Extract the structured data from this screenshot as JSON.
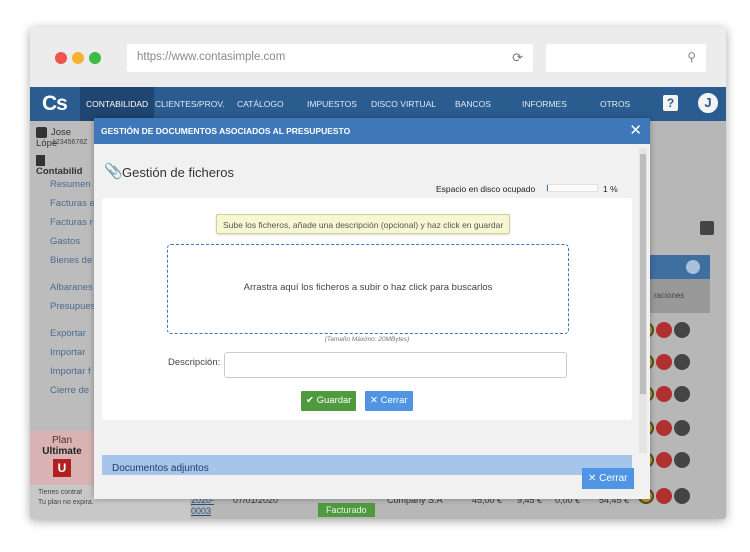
{
  "browser": {
    "url": "https://www.contasimple.com"
  },
  "app": {
    "logo": "Cs",
    "nav": [
      {
        "label": "CONTABILIDAD"
      },
      {
        "label": "CLIENTES/PROV."
      },
      {
        "label": "CATÁLOGO"
      },
      {
        "label": "IMPUESTOS"
      },
      {
        "label": "DISCO VIRTUAL"
      },
      {
        "label": "BANCOS"
      },
      {
        "label": "INFORMES"
      },
      {
        "label": "OTROS"
      }
    ],
    "help_label": "?",
    "avatar_initial": "J"
  },
  "sidebar": {
    "user_name": "Jose Lópe",
    "user_id": "12345678Z",
    "section_title": "Contabilid",
    "items": [
      {
        "label": "Resumen"
      },
      {
        "label": "Facturas e"
      },
      {
        "label": "Facturas r"
      },
      {
        "label": "Gastos"
      },
      {
        "label": "Bienes de"
      },
      {
        "label": "Albaranes"
      },
      {
        "label": "Presupues"
      },
      {
        "label": "Exportar"
      },
      {
        "label": "Importar"
      },
      {
        "label": "Importar f"
      },
      {
        "label": "Cierre de"
      }
    ],
    "plan_label": "Plan",
    "plan_name": "Ultimate",
    "plan_badge": "U",
    "plan_note_1": "Tienes contrat",
    "plan_note_2": "Tu plan no expira."
  },
  "background": {
    "operations_header": "raciones",
    "row": {
      "number_1": "2020-",
      "number_2": "0003",
      "date": "07/01/2020",
      "status": "Facturado",
      "client": "Company S.A",
      "amount_1": "45,00 €",
      "amount_2": "9,45 €",
      "amount_3": "0,00 €",
      "total": "54,45 €"
    }
  },
  "modal": {
    "title": "GESTIÓN DE DOCUMENTOS ASOCIADOS AL PRESUPUESTO",
    "close_symbol": "✕",
    "files_title": "Gestión de ficheros",
    "disk_label": "Espacio en disco ocupado",
    "disk_percent_label": "1 %",
    "disk_percent_value": 1,
    "hint": "Sube los ficheros, añade una descripción (opcional) y haz click en guardar",
    "dropzone_text": "Arrastra aquí los ficheros a subir o haz click para buscarlos",
    "max_size": "(Tamaño Máximo: 20MBytes)",
    "description_label": "Descripción:",
    "description_value": "",
    "save_label": "Guardar",
    "cancel_label": "Cerrar",
    "attached_docs": "Documentos adjuntos",
    "footer_close_label": "Cerrar"
  },
  "colors": {
    "navbar": "#2b5c8f",
    "modal_header": "#3f78b8",
    "save": "#4f9a3f",
    "cancel": "#4f95e3"
  }
}
